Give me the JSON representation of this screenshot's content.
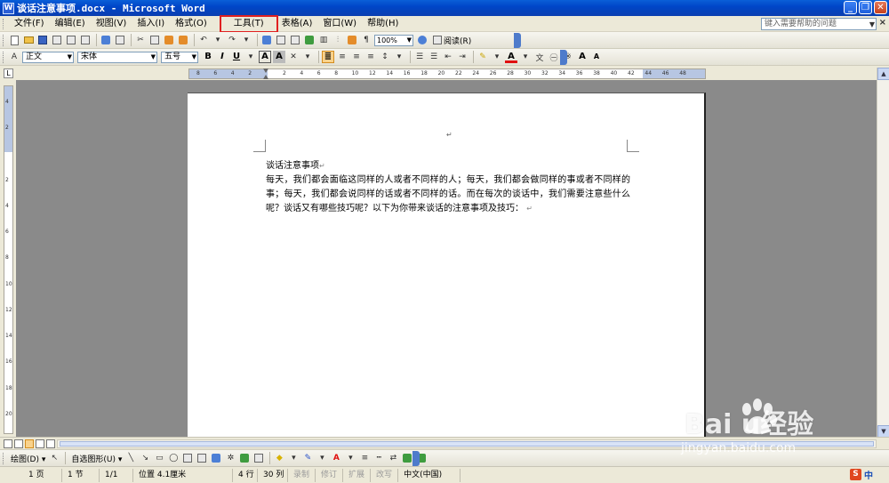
{
  "window": {
    "title": "谈话注意事项.docx - Microsoft Word",
    "app_icon": "W",
    "controls": {
      "minimize": "_",
      "restore": "❐",
      "close": "✕"
    }
  },
  "menu": {
    "items": [
      {
        "label": "文件(F)",
        "highlighted": false
      },
      {
        "label": "编辑(E)",
        "highlighted": false
      },
      {
        "label": "视图(V)",
        "highlighted": false
      },
      {
        "label": "插入(I)",
        "highlighted": false
      },
      {
        "label": "格式(O)",
        "highlighted": false
      },
      {
        "label": "工具(T)",
        "highlighted": true
      },
      {
        "label": "表格(A)",
        "highlighted": false
      },
      {
        "label": "窗口(W)",
        "highlighted": false
      },
      {
        "label": "帮助(H)",
        "highlighted": false
      }
    ],
    "help_placeholder": "键入需要帮助的问题",
    "close_doc": "×"
  },
  "toolbar": {
    "zoom": "100%",
    "read_label": "阅读(R)"
  },
  "format_bar": {
    "style": "正文",
    "font": "宋体",
    "size": "五号",
    "bold": "B",
    "italic": "I",
    "underline": "U",
    "char_border": "A",
    "char_scale": "A",
    "font_color": "A",
    "grow_font": "A",
    "shrink_font": "A"
  },
  "ruler": {
    "ticks": [
      "8",
      "6",
      "4",
      "2",
      "",
      "2",
      "4",
      "6",
      "8",
      "10",
      "12",
      "14",
      "16",
      "18",
      "20",
      "22",
      "24",
      "26",
      "28",
      "30",
      "32",
      "34",
      "36",
      "38",
      "40",
      "42",
      "44",
      "46",
      "48"
    ],
    "vticks": [
      "4",
      "2",
      "",
      "2",
      "4",
      "6",
      "8",
      "10",
      "12",
      "14",
      "16",
      "18",
      "20"
    ]
  },
  "document": {
    "title": "谈话注意事项",
    "body": "每天，我们都会面临这同样的人或者不同样的人；每天，我们都会做同样的事或者不同样的事；每天，我们都会说同样的话或者不同样的话。而在每次的谈话中，我们需要注意些什么呢？谈话又有哪些技巧呢？以下为你带来谈话的注意事项及技巧：",
    "paragraph_mark": "↵"
  },
  "draw_bar": {
    "draw_label": "绘图(D) ▾",
    "autoshape_label": "自选图形(U) ▾"
  },
  "status": {
    "page": "1 页",
    "section": "1 节",
    "page_of": "1/1",
    "position": "位置 4.1厘米",
    "line": "4 行",
    "column": "30 列",
    "rec": "录制",
    "trk": "修订",
    "ext": "扩展",
    "ovr": "改写",
    "language": "中文(中国)"
  },
  "ime": {
    "logo": "S",
    "mode": "中"
  },
  "watermark": {
    "brand": "Bai  u经验",
    "url": "jingyan.baidu.com"
  },
  "colors": {
    "titlebar": "#0046c8",
    "highlight_box": "#e02020",
    "page_bg": "#8a8a8a",
    "margin_blue": "#b7c6e2"
  }
}
